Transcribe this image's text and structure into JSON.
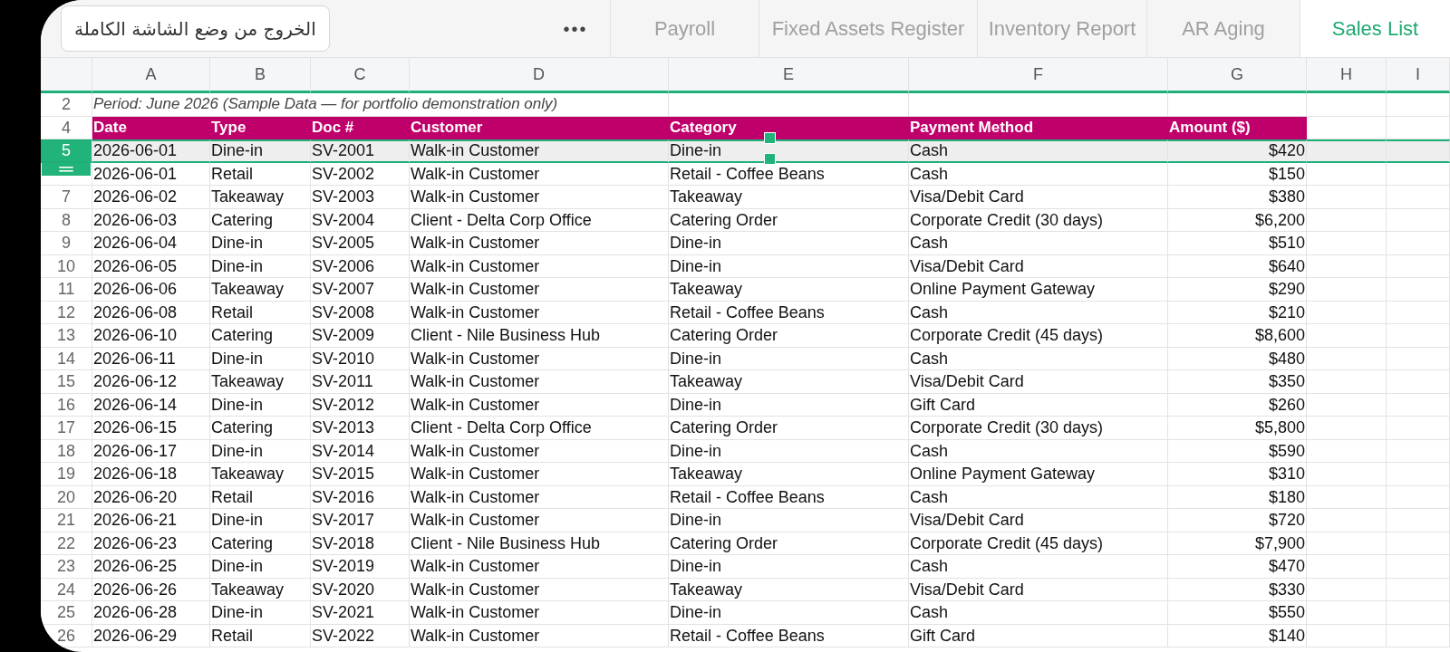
{
  "exit_fullscreen_button": "الخروج من وضع الشاشة الكاملة",
  "more_menu": "•••",
  "sheet_tabs": [
    {
      "label": "Payroll",
      "selected": false
    },
    {
      "label": "Fixed Assets Register",
      "selected": false
    },
    {
      "label": "Inventory Report",
      "selected": false
    },
    {
      "label": "AR Aging",
      "selected": false
    },
    {
      "label": "Sales List",
      "selected": true
    }
  ],
  "column_headers": [
    "A",
    "B",
    "C",
    "D",
    "E",
    "F",
    "G",
    "H",
    "I"
  ],
  "title_row": {
    "number": "2",
    "text": "Period: June 2026 (Sample Data — for portfolio demonstration only)"
  },
  "header_row": {
    "number": "4",
    "cells": [
      "Date",
      "Type",
      "Doc #",
      "Customer",
      "Category",
      "Payment Method",
      "Amount ($)"
    ]
  },
  "rows": [
    {
      "number": "5",
      "selected": true,
      "cells": [
        "2026-06-01",
        "Dine-in",
        "SV-2001",
        "Walk-in Customer",
        "Dine-in",
        "Cash",
        "$420"
      ]
    },
    {
      "selected": false,
      "cells": [
        "2026-06-01",
        "Retail",
        "SV-2002",
        "Walk-in Customer",
        "Retail - Coffee Beans",
        "Cash",
        "$150"
      ]
    },
    {
      "number": "7",
      "selected": false,
      "cells": [
        "2026-06-02",
        "Takeaway",
        "SV-2003",
        "Walk-in Customer",
        "Takeaway",
        "Visa/Debit Card",
        "$380"
      ]
    },
    {
      "number": "8",
      "selected": false,
      "cells": [
        "2026-06-03",
        "Catering",
        "SV-2004",
        "Client - Delta Corp Office",
        "Catering Order",
        "Corporate Credit (30 days)",
        "$6,200"
      ]
    },
    {
      "number": "9",
      "selected": false,
      "cells": [
        "2026-06-04",
        "Dine-in",
        "SV-2005",
        "Walk-in Customer",
        "Dine-in",
        "Cash",
        "$510"
      ]
    },
    {
      "number": "10",
      "selected": false,
      "cells": [
        "2026-06-05",
        "Dine-in",
        "SV-2006",
        "Walk-in Customer",
        "Dine-in",
        "Visa/Debit Card",
        "$640"
      ]
    },
    {
      "number": "11",
      "selected": false,
      "cells": [
        "2026-06-06",
        "Takeaway",
        "SV-2007",
        "Walk-in Customer",
        "Takeaway",
        "Online Payment Gateway",
        "$290"
      ]
    },
    {
      "number": "12",
      "selected": false,
      "cells": [
        "2026-06-08",
        "Retail",
        "SV-2008",
        "Walk-in Customer",
        "Retail - Coffee Beans",
        "Cash",
        "$210"
      ]
    },
    {
      "number": "13",
      "selected": false,
      "cells": [
        "2026-06-10",
        "Catering",
        "SV-2009",
        "Client - Nile Business Hub",
        "Catering Order",
        "Corporate Credit (45 days)",
        "$8,600"
      ]
    },
    {
      "number": "14",
      "selected": false,
      "cells": [
        "2026-06-11",
        "Dine-in",
        "SV-2010",
        "Walk-in Customer",
        "Dine-in",
        "Cash",
        "$480"
      ]
    },
    {
      "number": "15",
      "selected": false,
      "cells": [
        "2026-06-12",
        "Takeaway",
        "SV-2011",
        "Walk-in Customer",
        "Takeaway",
        "Visa/Debit Card",
        "$350"
      ]
    },
    {
      "number": "16",
      "selected": false,
      "cells": [
        "2026-06-14",
        "Dine-in",
        "SV-2012",
        "Walk-in Customer",
        "Dine-in",
        "Gift Card",
        "$260"
      ]
    },
    {
      "number": "17",
      "selected": false,
      "cells": [
        "2026-06-15",
        "Catering",
        "SV-2013",
        "Client - Delta Corp Office",
        "Catering Order",
        "Corporate Credit (30 days)",
        "$5,800"
      ]
    },
    {
      "number": "18",
      "selected": false,
      "cells": [
        "2026-06-17",
        "Dine-in",
        "SV-2014",
        "Walk-in Customer",
        "Dine-in",
        "Cash",
        "$590"
      ]
    },
    {
      "number": "19",
      "selected": false,
      "cells": [
        "2026-06-18",
        "Takeaway",
        "SV-2015",
        "Walk-in Customer",
        "Takeaway",
        "Online Payment Gateway",
        "$310"
      ]
    },
    {
      "number": "20",
      "selected": false,
      "cells": [
        "2026-06-20",
        "Retail",
        "SV-2016",
        "Walk-in Customer",
        "Retail - Coffee Beans",
        "Cash",
        "$180"
      ]
    },
    {
      "number": "21",
      "selected": false,
      "cells": [
        "2026-06-21",
        "Dine-in",
        "SV-2017",
        "Walk-in Customer",
        "Dine-in",
        "Visa/Debit Card",
        "$720"
      ]
    },
    {
      "number": "22",
      "selected": false,
      "cells": [
        "2026-06-23",
        "Catering",
        "SV-2018",
        "Client - Nile Business Hub",
        "Catering Order",
        "Corporate Credit (45 days)",
        "$7,900"
      ]
    },
    {
      "number": "23",
      "selected": false,
      "cells": [
        "2026-06-25",
        "Dine-in",
        "SV-2019",
        "Walk-in Customer",
        "Dine-in",
        "Cash",
        "$470"
      ]
    },
    {
      "number": "24",
      "selected": false,
      "cells": [
        "2026-06-26",
        "Takeaway",
        "SV-2020",
        "Walk-in Customer",
        "Takeaway",
        "Visa/Debit Card",
        "$330"
      ]
    },
    {
      "number": "25",
      "selected": false,
      "cells": [
        "2026-06-28",
        "Dine-in",
        "SV-2021",
        "Walk-in Customer",
        "Dine-in",
        "Cash",
        "$550"
      ]
    },
    {
      "number": "26",
      "selected": false,
      "cells": [
        "2026-06-29",
        "Retail",
        "SV-2022",
        "Walk-in Customer",
        "Retail - Coffee Beans",
        "Gift Card",
        "$140"
      ]
    }
  ]
}
